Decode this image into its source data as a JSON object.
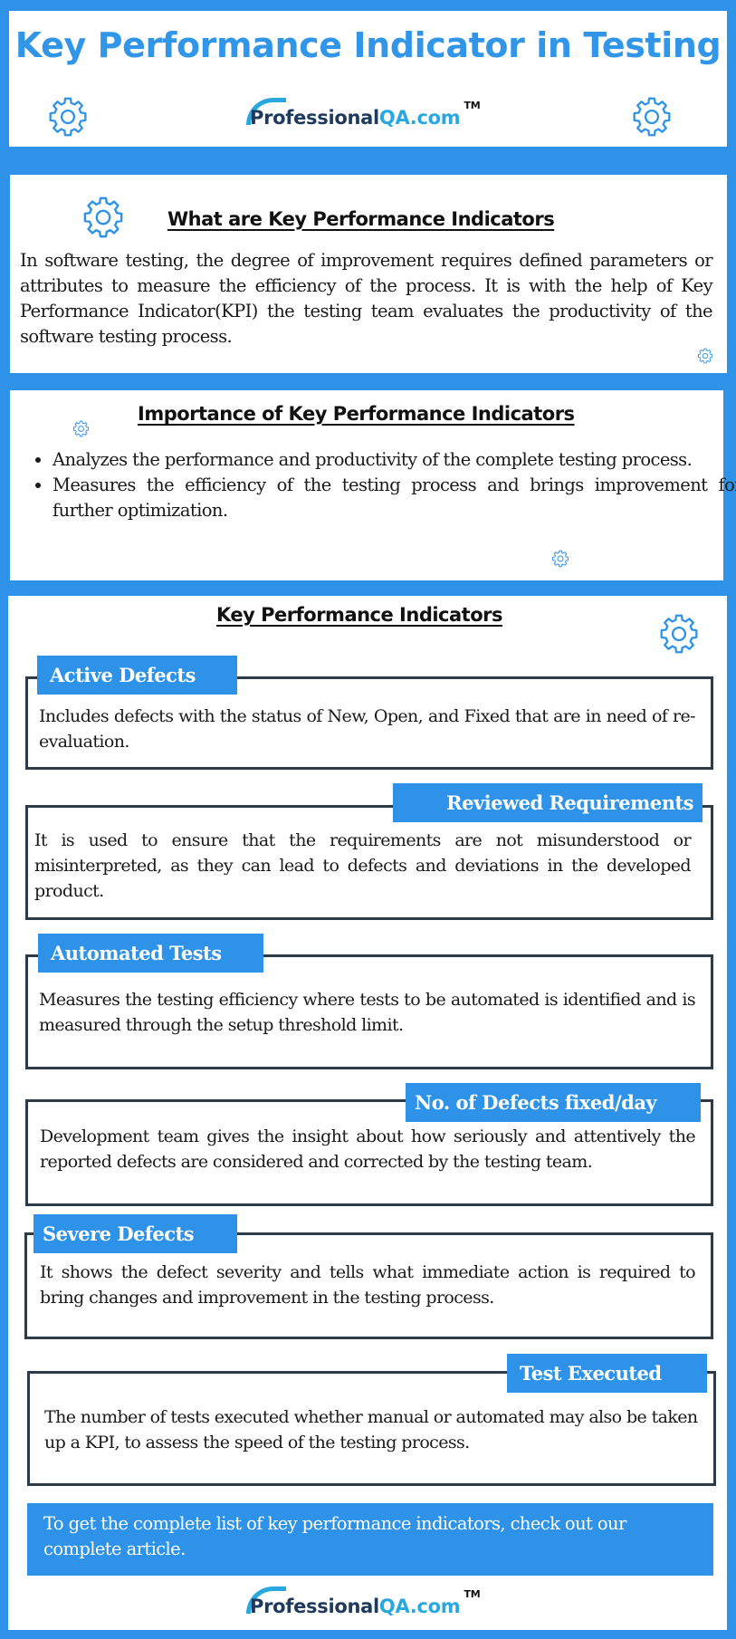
{
  "header": {
    "title": "Key Performance Indicator in Testing",
    "logo": {
      "part1": "Professional",
      "part2": "QA.com",
      "trademark": "TM"
    },
    "icons": [
      "gear-icon",
      "gear-icon"
    ]
  },
  "what_section": {
    "heading": "What are Key Performance Indicators",
    "text": "In software testing, the degree of improvement requires defined parameters or attributes to measure the efficiency of the process. It is with the help of Key Performance Indicator(KPI) the testing team evaluates the productivity of the software testing process."
  },
  "importance_section": {
    "heading": "Importance of Key Performance Indicators",
    "bullets": [
      "Analyzes the performance and productivity of the complete testing process.",
      "Measures the efficiency of the testing process and brings improvement for further optimization."
    ]
  },
  "kpi_section": {
    "heading": "Key Performance Indicators",
    "items": [
      {
        "label": "Active Defects",
        "text": "Includes defects with the status of New, Open, and Fixed that are in need of re-evaluation."
      },
      {
        "label": "Reviewed Requirements",
        "text": " It is used to ensure that the requirements are not misunderstood or misinterpreted, as they can lead to defects and deviations in the developed product."
      },
      {
        "label": "Automated Tests",
        "text": "Measures the testing efficiency where tests to be automated is identified and is measured through the setup threshold limit."
      },
      {
        "label": "No. of Defects fixed/day",
        "text": "Development team gives the insight about how seriously and attentively the reported defects are considered and corrected by the testing team."
      },
      {
        "label": "Severe Defects",
        "text": "It shows the defect severity and tells what immediate action is required to bring changes and improvement in the testing process."
      },
      {
        "label": "Test Executed",
        "text": "The number of tests executed whether manual or automated may also be taken up a KPI, to assess the speed of the testing process."
      }
    ],
    "cta": "To get the complete list of key performance indicators, check out our complete article."
  },
  "footer": {
    "logo": {
      "part1": "Professional",
      "part2": "QA.com",
      "trademark": "TM"
    }
  },
  "colors": {
    "brand_blue": "#2e93e8",
    "title_blue": "#3196e8",
    "logo_navy": "#1e3a5c",
    "logo_light_blue": "#29a8e0",
    "box_border": "#2d3a48"
  }
}
